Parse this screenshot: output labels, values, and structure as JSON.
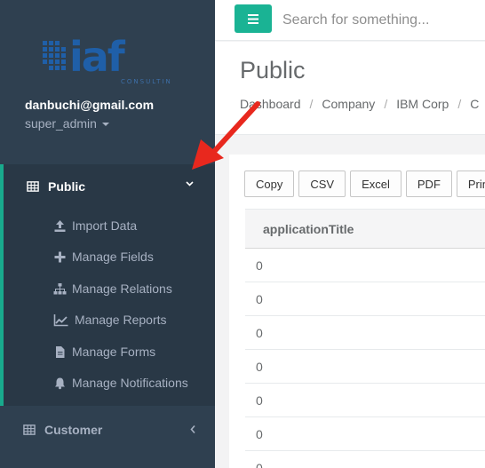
{
  "sidebar": {
    "logo": {
      "brand": "iaf",
      "tagline": "CONSULTING"
    },
    "user": {
      "email": "danbuchi@gmail.com",
      "role": "super_admin"
    },
    "nav": {
      "public": {
        "label": "Public",
        "icon": "table-icon"
      },
      "sub_items": [
        {
          "label": "Import Data",
          "icon": "upload-icon"
        },
        {
          "label": "Manage Fields",
          "icon": "plus-icon"
        },
        {
          "label": "Manage Relations",
          "icon": "sitemap-icon"
        },
        {
          "label": "Manage Reports",
          "icon": "line-chart-icon"
        },
        {
          "label": "Manage Forms",
          "icon": "file-icon"
        },
        {
          "label": "Manage Notifications",
          "icon": "bell-icon"
        }
      ],
      "customer": {
        "label": "Customer",
        "icon": "table-icon"
      }
    }
  },
  "topbar": {
    "search_placeholder": "Search for something..."
  },
  "page": {
    "title": "Public",
    "breadcrumb": [
      "Dashboard",
      "Company",
      "IBM Corp",
      "C"
    ]
  },
  "table_tools": {
    "buttons": [
      "Copy",
      "CSV",
      "Excel",
      "PDF",
      "Print"
    ]
  },
  "table": {
    "columns": [
      "applicationTitle"
    ],
    "rows": [
      "0",
      "0",
      "0",
      "0",
      "0",
      "0",
      "0"
    ]
  },
  "colors": {
    "sidebar": "#2f4050",
    "accent": "#1ab394",
    "annotation": "#e8281e"
  }
}
